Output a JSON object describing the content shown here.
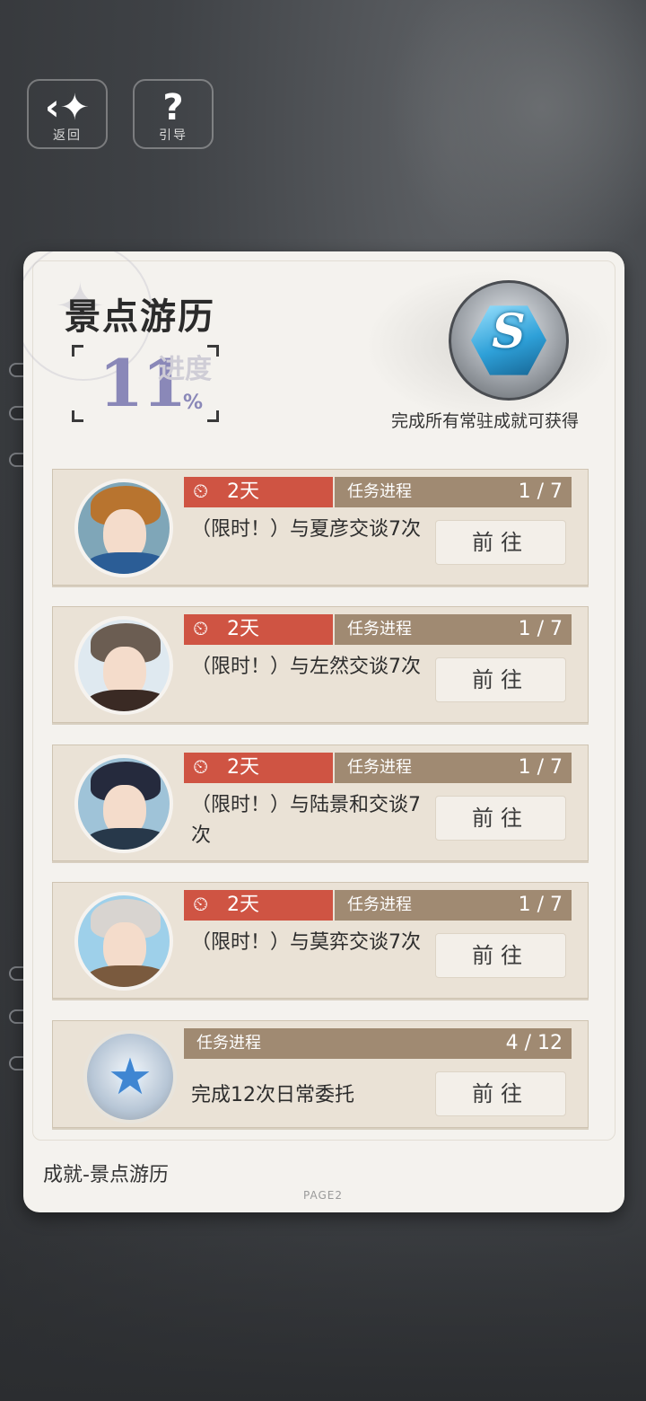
{
  "top_bar": {
    "back": {
      "icon": "back-arrow-icon",
      "label": "返回"
    },
    "guide": {
      "icon": "question-icon",
      "label": "引导"
    }
  },
  "panel": {
    "title": "景点游历",
    "progress": {
      "label": "进度",
      "value": "11",
      "unit": "%"
    },
    "badge": {
      "letter": "S",
      "caption": "完成所有常驻成就可获得"
    },
    "footer_title": "成就-景点游历",
    "page": "PAGE2"
  },
  "tasks": [
    {
      "time_left": "2天",
      "progress_label": "任务进程",
      "progress": "1 / 7",
      "description": "（限时！）与夏彦交谈7次",
      "button": "前往"
    },
    {
      "time_left": "2天",
      "progress_label": "任务进程",
      "progress": "1 / 7",
      "description": "（限时！）与左然交谈7次",
      "button": "前往"
    },
    {
      "time_left": "2天",
      "progress_label": "任务进程",
      "progress": "1 / 7",
      "description": "（限时！）与陆景和交谈7次",
      "button": "前往"
    },
    {
      "time_left": "2天",
      "progress_label": "任务进程",
      "progress": "1 / 7",
      "description": "（限时！）与莫弈交谈7次",
      "button": "前往"
    },
    {
      "progress_label": "任务进程",
      "progress": "4 / 12",
      "description": "完成12次日常委托",
      "button": "前往"
    }
  ],
  "colors": {
    "time_tag": "#cf5443",
    "progress_bar": "#a08a72",
    "progress_value": "#8a88b8"
  }
}
